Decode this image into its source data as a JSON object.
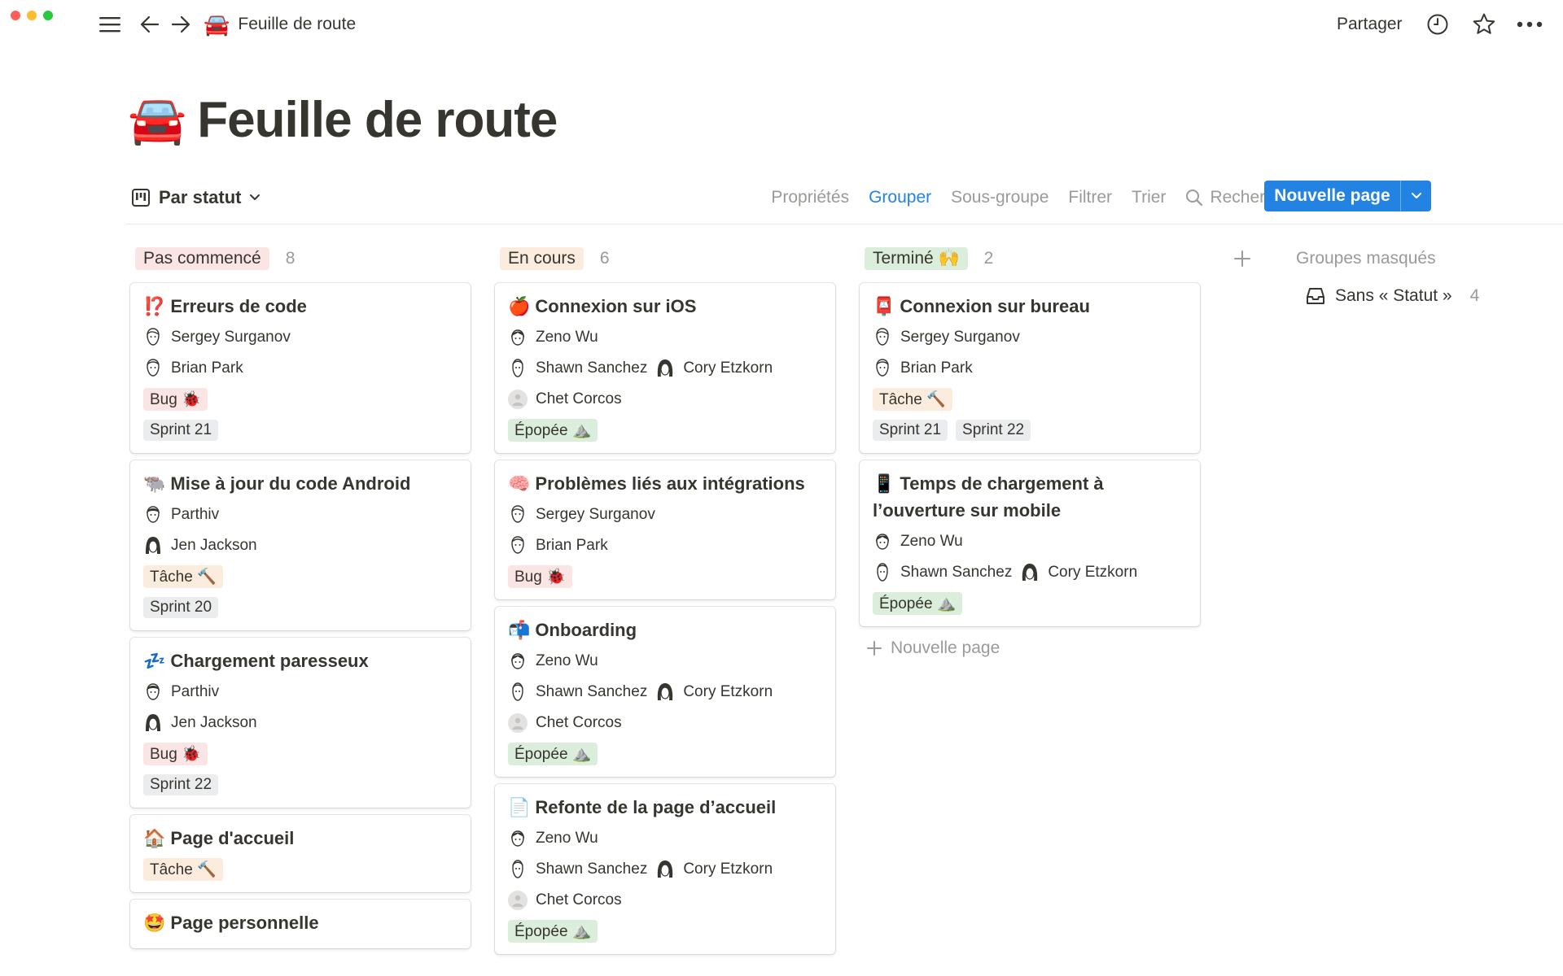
{
  "topbar": {
    "breadcrumb_emoji": "🚘",
    "breadcrumb_title": "Feuille de route",
    "share_label": "Partager"
  },
  "page": {
    "emoji": "🚘",
    "title": "Feuille de route"
  },
  "viewbar": {
    "view_label": "Par statut",
    "actions": [
      "Propriétés",
      "Grouper",
      "Sous-groupe",
      "Filtrer",
      "Trier"
    ],
    "search_label": "Rechercher",
    "new_page_label": "Nouvelle page"
  },
  "columns": [
    {
      "label": "Pas commencé",
      "count": "8",
      "color": "#fbe4e4",
      "cards": [
        {
          "emoji": "⁉️",
          "title": "Erreurs de code",
          "people": [
            [
              "Sergey Surganov"
            ],
            [
              "Brian Park"
            ]
          ],
          "type": "Bug 🐞",
          "type_color": "red",
          "sprints": [
            "Sprint 21"
          ]
        },
        {
          "emoji": "🐃",
          "title": "Mise à jour du code Android",
          "people": [
            [
              "Parthiv"
            ],
            [
              "Jen Jackson"
            ]
          ],
          "type": "Tâche 🔨",
          "type_color": "orange",
          "sprints": [
            "Sprint 20"
          ]
        },
        {
          "emoji": "💤",
          "title": "Chargement paresseux",
          "people": [
            [
              "Parthiv"
            ],
            [
              "Jen Jackson"
            ]
          ],
          "type": "Bug 🐞",
          "type_color": "red",
          "sprints": [
            "Sprint 22"
          ]
        },
        {
          "emoji": "🏠",
          "title": "Page d'accueil",
          "people": [],
          "type": "Tâche 🔨",
          "type_color": "orange",
          "sprints": []
        },
        {
          "emoji": "🤩",
          "title": "Page personnelle",
          "people": [],
          "type": "",
          "type_color": "",
          "sprints": []
        }
      ]
    },
    {
      "label": "En cours",
      "count": "6",
      "color": "#fbecdd",
      "cards": [
        {
          "emoji": "🍎",
          "title": "Connexion sur iOS",
          "people": [
            [
              "Zeno Wu"
            ],
            [
              "Shawn Sanchez",
              "Cory Etzkorn"
            ],
            [
              "Chet Corcos"
            ]
          ],
          "type": "Épopée ⛰️",
          "type_color": "green",
          "sprints": []
        },
        {
          "emoji": "🧠",
          "title": "Problèmes liés aux intégrations",
          "people": [
            [
              "Sergey Surganov"
            ],
            [
              "Brian Park"
            ]
          ],
          "type": "Bug 🐞",
          "type_color": "red",
          "sprints": []
        },
        {
          "emoji": "📬",
          "title": "Onboarding",
          "people": [
            [
              "Zeno Wu"
            ],
            [
              "Shawn Sanchez",
              "Cory Etzkorn"
            ],
            [
              "Chet Corcos"
            ]
          ],
          "type": "Épopée ⛰️",
          "type_color": "green",
          "sprints": []
        },
        {
          "emoji": "📄",
          "title": "Refonte de la page d’accueil",
          "people": [
            [
              "Zeno Wu"
            ],
            [
              "Shawn Sanchez",
              "Cory Etzkorn"
            ],
            [
              "Chet Corcos"
            ]
          ],
          "type": "Épopée ⛰️",
          "type_color": "green",
          "sprints": []
        }
      ]
    },
    {
      "label": "Terminé 🙌",
      "count": "2",
      "color": "#dbeddb",
      "cards": [
        {
          "emoji": "📮",
          "title": "Connexion sur bureau",
          "people": [
            [
              "Sergey Surganov"
            ],
            [
              "Brian Park"
            ]
          ],
          "type": "Tâche 🔨",
          "type_color": "orange",
          "sprints": [
            "Sprint 21",
            "Sprint 22"
          ]
        },
        {
          "emoji": "📱",
          "title": "Temps de chargement à l’ouverture sur mobile",
          "people": [
            [
              "Zeno Wu"
            ],
            [
              "Shawn Sanchez",
              "Cory Etzkorn"
            ]
          ],
          "type": "Épopée ⛰️",
          "type_color": "green",
          "sprints": []
        }
      ],
      "new_page_label": "Nouvelle page"
    }
  ],
  "hidden_groups": {
    "title": "Groupes masqués",
    "items": [
      {
        "label": "Sans « Statut »",
        "count": "4"
      }
    ]
  },
  "colors": {
    "accent": "#2383e2",
    "text": "#37352f",
    "muted": "#9b9a97"
  }
}
